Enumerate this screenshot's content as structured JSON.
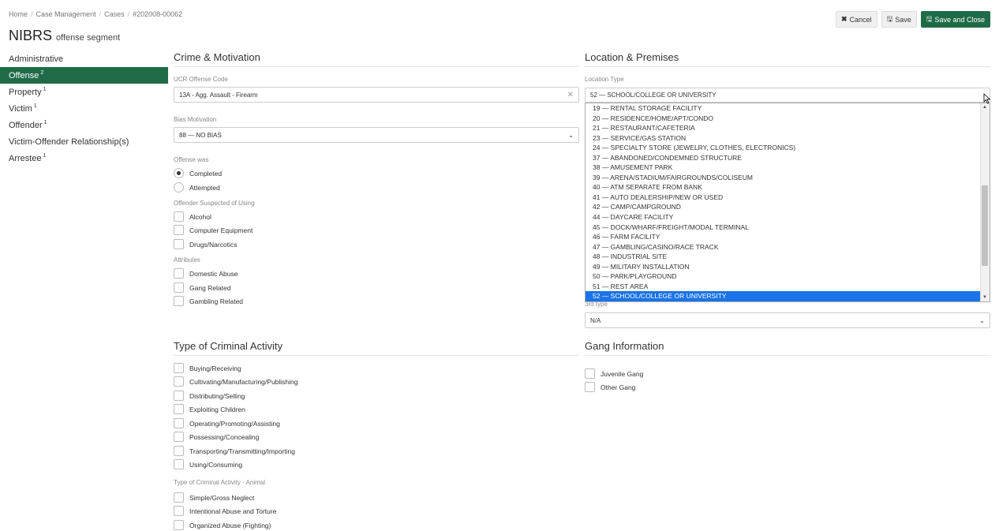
{
  "breadcrumb": [
    "Home",
    "Case Management",
    "Cases",
    "#202008-00062"
  ],
  "title": {
    "main": "NIBRS",
    "sub": "offense segment"
  },
  "actions": {
    "cancel": "Cancel",
    "save": "Save",
    "save_close": "Save and Close"
  },
  "nav": [
    {
      "label": "Administrative",
      "count": ""
    },
    {
      "label": "Offense",
      "count": "2"
    },
    {
      "label": "Property",
      "count": "1"
    },
    {
      "label": "Victim",
      "count": "1"
    },
    {
      "label": "Offender",
      "count": "1"
    },
    {
      "label": "Victim-Offender Relationship(s)",
      "count": ""
    },
    {
      "label": "Arrestee",
      "count": "1"
    }
  ],
  "crime": {
    "section_title": "Crime & Motivation",
    "ucr_label": "UCR Offense Code",
    "ucr_value": "13A - Agg. Assault - Firearm",
    "bias_label": "Bias Motivation",
    "bias_value": "88 — NO BIAS",
    "offense_was_label": "Offense was",
    "offense_options": [
      "Completed",
      "Attempted"
    ],
    "suspected_label": "Offender Suspected of Using",
    "suspected_options": [
      "Alcohol",
      "Computer Equipment",
      "Drugs/Narcotics"
    ],
    "attributes_label": "Attributes",
    "attributes_options": [
      "Domestic Abuse",
      "Gang Related",
      "Gambling Related"
    ]
  },
  "location": {
    "section_title": "Location & Premises",
    "type_label": "Location Type",
    "type_value": "52 — SCHOOL/COLLEGE OR UNIVERSITY",
    "third_type_label": "3rd type",
    "third_type_value": "N/A",
    "dropdown_options": [
      "19 — RENTAL STORAGE FACILITY",
      "20 — RESIDENCE/HOME/APT/CONDO",
      "21 — RESTAURANT/CAFETERIA",
      "23 — SERVICE/GAS STATION",
      "24 — SPECIALTY STORE (JEWELRY, CLOTHES, ELECTRONICS)",
      "37 — ABANDONED/CONDEMNED STRUCTURE",
      "38 — AMUSEMENT PARK",
      "39 — ARENA/STADIUM/FAIRGROUNDS/COLISEUM",
      "40 — ATM SEPARATE FROM BANK",
      "41 — AUTO DEALERSHIP/NEW OR USED",
      "42 — CAMP/CAMPGROUND",
      "44 — DAYCARE FACILITY",
      "45 — DOCK/WHARF/FREIGHT/MODAL TERMINAL",
      "46 — FARM FACILITY",
      "47 — GAMBLING/CASINO/RACE TRACK",
      "48 — INDUSTRIAL SITE",
      "49 — MILITARY INSTALLATION",
      "50 — PARK/PLAYGROUND",
      "51 — REST AREA",
      "52 — SCHOOL/COLLEGE OR UNIVERSITY"
    ]
  },
  "activity": {
    "section_title": "Type of Criminal Activity",
    "options": [
      "Buying/Receiving",
      "Cultivating/Manufacturing/Publishing",
      "Distributing/Selling",
      "Exploiting Children",
      "Operating/Promoting/Assisting",
      "Possessing/Concealing",
      "Transporting/Transmitting/Importing",
      "Using/Consuming"
    ],
    "animal_label": "Type of Criminal Activity - Animal",
    "animal_options": [
      "Simple/Gross Neglect",
      "Intentional Abuse and Torture",
      "Organized Abuse (Fighting)"
    ]
  },
  "gang": {
    "section_title": "Gang Information",
    "options": [
      "Juvenile Gang",
      "Other Gang"
    ]
  }
}
